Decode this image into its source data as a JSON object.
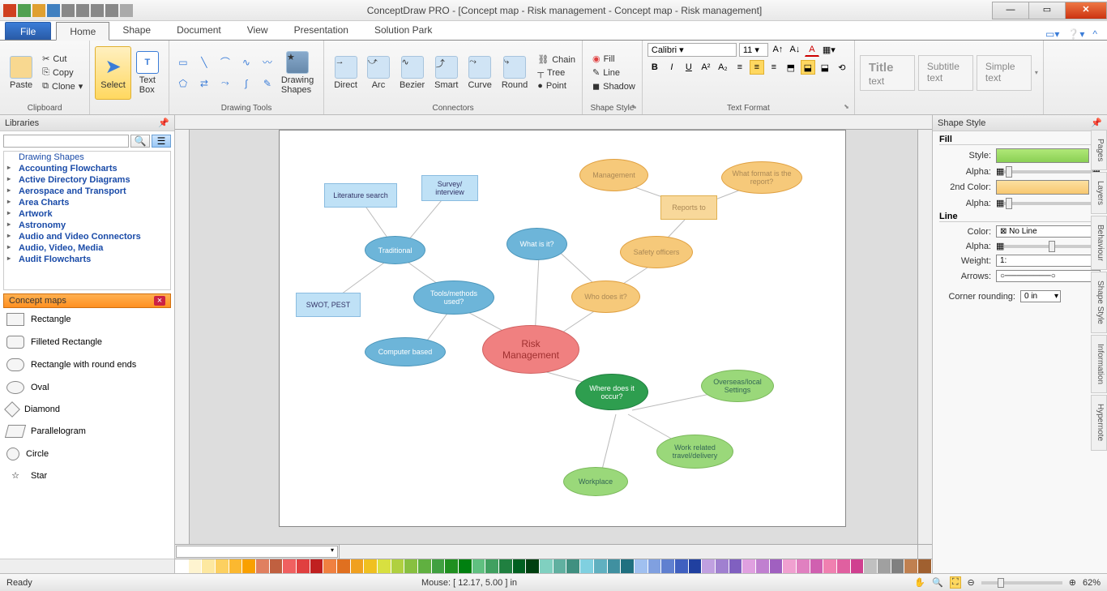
{
  "app": {
    "title": "ConceptDraw PRO - [Concept map - Risk management - Concept map - Risk management]"
  },
  "qat_icons": [
    "app",
    "new",
    "open",
    "save",
    "undo",
    "redo",
    "print",
    "cut",
    "copy"
  ],
  "tabs": {
    "file": "File",
    "items": [
      "Home",
      "Shape",
      "Document",
      "View",
      "Presentation",
      "Solution Park"
    ],
    "active": "Home"
  },
  "ribbon": {
    "clipboard": {
      "label": "Clipboard",
      "paste": "Paste",
      "cut": "Cut",
      "copy": "Copy",
      "clone": "Clone"
    },
    "select": {
      "label": "Select",
      "textbox": "Text\nBox"
    },
    "drawtools": {
      "label": "Drawing Tools",
      "shapes": "Drawing\nShapes"
    },
    "connectors": {
      "label": "Connectors",
      "direct": "Direct",
      "arc": "Arc",
      "bezier": "Bezier",
      "smart": "Smart",
      "curve": "Curve",
      "round": "Round",
      "chain": "Chain",
      "tree": "Tree",
      "point": "Point"
    },
    "shapestyle": {
      "label": "Shape Style",
      "fill": "Fill",
      "line": "Line",
      "shadow": "Shadow"
    },
    "textformat": {
      "label": "Text Format",
      "font": "Calibri",
      "size": "11"
    },
    "presets": {
      "title": "Title text",
      "subtitle": "Subtitle text",
      "simple": "Simple text"
    }
  },
  "libraries": {
    "header": "Libraries",
    "items": [
      "Drawing Shapes",
      "Accounting Flowcharts",
      "Active Directory Diagrams",
      "Aerospace and Transport",
      "Area Charts",
      "Artwork",
      "Astronomy",
      "Audio and Video Connectors",
      "Audio, Video, Media",
      "Audit Flowcharts"
    ],
    "cmaps": "Concept maps",
    "shapes": [
      "Rectangle",
      "Filleted Rectangle",
      "Rectangle with round ends",
      "Oval",
      "Diamond",
      "Parallelogram",
      "Circle",
      "Star"
    ]
  },
  "canvas": {
    "nodes": {
      "lit": "Literature search",
      "survey": "Survey/\ninterview",
      "mgmt": "Management",
      "format": "What format is the\nreport?",
      "reports": "Reports to",
      "trad": "Traditional",
      "whatis": "What is it?",
      "safety": "Safety officers",
      "swot": "SWOT, PEST",
      "tools": "Tools/methods\nused?",
      "who": "Who does it?",
      "comp": "Computer based",
      "risk": "Risk\nManagement",
      "where": "Where does it\noccur?",
      "overseas": "Overseas/local\nSettings",
      "travel": "Work related\ntravel/delivery",
      "workplace": "Workplace"
    }
  },
  "rightpane": {
    "header": "Shape Style",
    "fill": "Fill",
    "style": "Style:",
    "alpha": "Alpha:",
    "color2": "2nd Color:",
    "line": "Line",
    "color": "Color:",
    "noline": "No Line",
    "weight": "Weight:",
    "weightval": "1:",
    "arrows": "Arrows:",
    "arrowval": "0:",
    "corner": "Corner rounding:",
    "cornerval": "0 in",
    "sidetabs": [
      "Pages",
      "Layers",
      "Behaviour",
      "Shape Style",
      "Information",
      "Hypernote"
    ]
  },
  "status": {
    "ready": "Ready",
    "mouse": "Mouse: [ 12.17, 5.00 ] in",
    "zoom": "62%"
  },
  "palette": [
    "#fff",
    "#fef4d0",
    "#fde8a0",
    "#fcd060",
    "#fbb830",
    "#f9a000",
    "#e08060",
    "#c06040",
    "#f06060",
    "#e04040",
    "#c02020",
    "#f08040",
    "#e07020",
    "#f0a020",
    "#f0c020",
    "#d8e040",
    "#b0d040",
    "#88c040",
    "#60b040",
    "#40a040",
    "#209020",
    "#008010",
    "#60c080",
    "#40a060",
    "#208040",
    "#006020",
    "#004010",
    "#80d0c0",
    "#60b0a0",
    "#409080",
    "#80d0e0",
    "#60b0c0",
    "#4090a0",
    "#207080",
    "#a0c0f0",
    "#80a0e0",
    "#6080d0",
    "#4060c0",
    "#2040a0",
    "#c0a0e0",
    "#a080d0",
    "#8060c0",
    "#e0a0e0",
    "#c080d0",
    "#a060c0",
    "#f0a0d0",
    "#e080c0",
    "#d060b0",
    "#f080b0",
    "#e060a0",
    "#d04090",
    "#c0c0c0",
    "#a0a0a0",
    "#808080",
    "#c08050",
    "#a06030"
  ]
}
